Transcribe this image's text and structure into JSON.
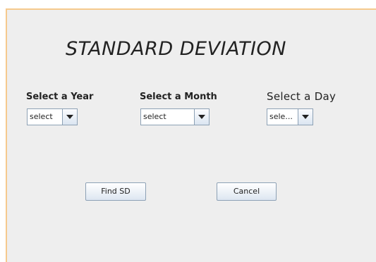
{
  "title": "STANDARD DEVIATION",
  "year": {
    "label": "Select a Year",
    "value": "select"
  },
  "month": {
    "label": "Select a Month",
    "value": "select"
  },
  "day": {
    "label": "Select a Day",
    "value": "sele..."
  },
  "buttons": {
    "find": "Find SD",
    "cancel": "Cancel"
  },
  "colors": {
    "window_bg": "#eeeeee",
    "frame_border": "#f6c98d",
    "control_border": "#8da1b5"
  }
}
